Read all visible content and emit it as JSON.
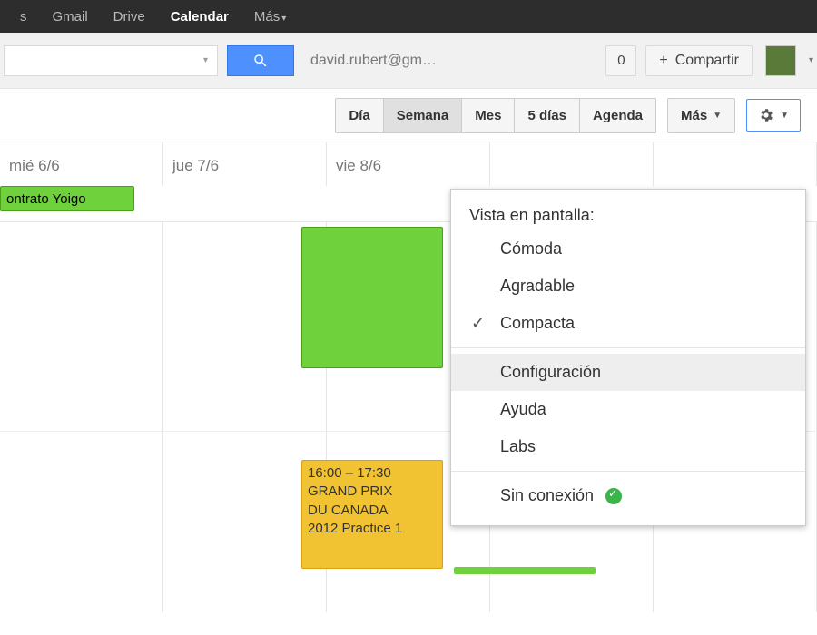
{
  "topnav": {
    "items": [
      {
        "label": "s"
      },
      {
        "label": "Gmail"
      },
      {
        "label": "Drive"
      },
      {
        "label": "Calendar",
        "active": true
      },
      {
        "label": "Más"
      }
    ]
  },
  "toolbar": {
    "search_value": "",
    "account_email": "david.rubert@gm…",
    "share_count": "0",
    "share_label": "Compartir"
  },
  "viewrow": {
    "buttons": [
      {
        "label": "Día"
      },
      {
        "label": "Semana",
        "active": true
      },
      {
        "label": "Mes"
      },
      {
        "label": "5 días"
      },
      {
        "label": "Agenda"
      }
    ],
    "more_label": "Más"
  },
  "calendar": {
    "days": [
      {
        "label": "mié 6/6"
      },
      {
        "label": "jue 7/6"
      },
      {
        "label": "vie 8/6"
      },
      {
        "label": ""
      },
      {
        "label": ""
      }
    ],
    "events": {
      "yoigo": {
        "title": "ontrato Yoigo"
      },
      "grandprix": {
        "time": "16:00 – 17:30",
        "line1": "GRAND PRIX",
        "line2": "DU CANADA",
        "line3": "2012 Practice 1"
      }
    }
  },
  "menu": {
    "header": "Vista en pantalla:",
    "density": [
      {
        "label": "Cómoda"
      },
      {
        "label": "Agradable"
      },
      {
        "label": "Compacta",
        "selected": true
      }
    ],
    "options": [
      {
        "label": "Configuración",
        "highlight": true
      },
      {
        "label": "Ayuda"
      },
      {
        "label": "Labs"
      }
    ],
    "offline": {
      "label": "Sin conexión"
    }
  }
}
